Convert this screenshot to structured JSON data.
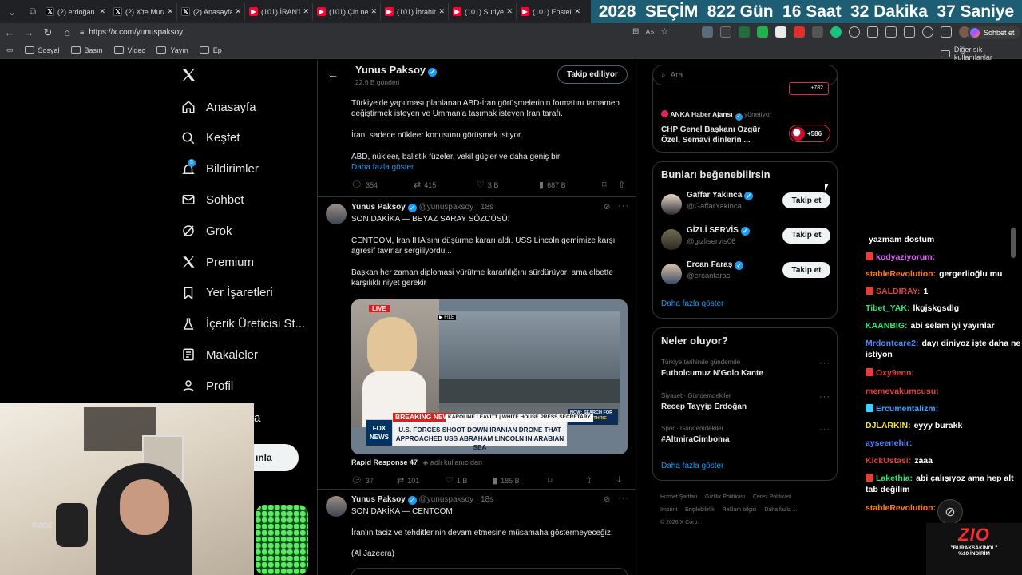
{
  "tabs": [
    {
      "label": "(2) erdoğan",
      "icon": "x-icon",
      "color": "#ffffff"
    },
    {
      "label": "(2) X'te Mura",
      "icon": "x-icon",
      "color": "#ffffff"
    },
    {
      "label": "(2) Anasayfa",
      "icon": "x-icon",
      "color": "#ffffff"
    },
    {
      "label": "(101) İRAN'D",
      "icon": "youtube-icon",
      "color": "#ff0033"
    },
    {
      "label": "(101) Çin ne",
      "icon": "youtube-icon",
      "color": "#ff0033"
    },
    {
      "label": "(101) İbrahim",
      "icon": "youtube-icon",
      "color": "#ff0033"
    },
    {
      "label": "(101) Suriye",
      "icon": "youtube-icon",
      "color": "#ff0033"
    },
    {
      "label": "(101) Epstein",
      "icon": "youtube-icon",
      "color": "#ff0033"
    }
  ],
  "countdown": {
    "year": "2028",
    "label": "SEÇİM",
    "days": "822 Gün",
    "hours": "16 Saat",
    "minutes": "32 Dakika",
    "seconds": "37 Saniye"
  },
  "address": {
    "url": "https://x.com/yunuspaksoy",
    "chat_button": "Sohbet et"
  },
  "bookmarks": [
    "Sosyal",
    "Basın",
    "Video",
    "Yayın",
    "Ep"
  ],
  "bookmarks_right": "Diğer sık kullanılanlar",
  "sidebar": {
    "items": [
      {
        "label": "Anasayfa",
        "icon": "home-icon"
      },
      {
        "label": "Keşfet",
        "icon": "search-icon"
      },
      {
        "label": "Bildirimler",
        "icon": "bell-icon",
        "badge": "3"
      },
      {
        "label": "Sohbet",
        "icon": "mail-icon"
      },
      {
        "label": "Grok",
        "icon": "grok-icon"
      },
      {
        "label": "Premium",
        "icon": "x-icon"
      },
      {
        "label": "Yer İşaretleri",
        "icon": "bookmark-icon"
      },
      {
        "label": "İçerik Üreticisi St...",
        "icon": "flask-icon"
      },
      {
        "label": "Makaleler",
        "icon": "article-icon"
      },
      {
        "label": "Profil",
        "icon": "person-icon"
      }
    ],
    "post_fragment": "ınla",
    "more_fragment": "a"
  },
  "profile_header": {
    "name": "Yunus Paksoy",
    "posts": "22,6 B gönderi",
    "follow_label": "Takip ediliyor"
  },
  "tweet0": {
    "lines": [
      "Türkiye'de yapılması planlanan ABD-İran görüşmelerinin formatını tamamen değiştirmek isteyen ve Umman'a taşımak isteyen İran tarafı.",
      "İran, sadece nükleer konusunu görüşmek istiyor.",
      "ABD, nükleer, balistik füzeler, vekil güçler ve daha geniş bir"
    ],
    "show_more": "Daha fazla göster",
    "replies": "354",
    "reposts": "415",
    "likes": "3 B",
    "views": "687 B"
  },
  "tweet1": {
    "name": "Yunus Paksoy",
    "handle": "@yunuspaksoy",
    "time": "· 18s",
    "lines": [
      "SON DAKİKA — BEYAZ SARAY SÖZCÜSÜ:",
      "CENTCOM, İran İHA'sını düşürme kararı aldı. USS Lincoln gemimize karşı agresif tavırlar sergiliyordu...",
      "Başkan her zaman diplomasi yürütme kararlılığını sürdürüyor; ama elbette karşılıklı niyet gerekir"
    ],
    "media": {
      "live": "LIVE",
      "file": "▶ FILE",
      "breaking": "BREAKING NEWS",
      "speaker": "KAROLINE LEAVITT | WHITE HOUSE PRESS SECRETARY",
      "headline1": "U.S. FORCES SHOOT DOWN IRANIAN DRONE THAT",
      "headline2": "APPROACHED USS ABRAHAM LINCOLN IN ARABIAN SEA",
      "fox1": "FOX",
      "fox2": "NEWS",
      "side1": "NOW: SEARCH FOR",
      "side2": "NANCY GUTHRIE"
    },
    "source": "Rapid Response 47",
    "source_sub": "adlı kullanıcıdan",
    "replies": "37",
    "reposts": "101",
    "likes": "1 B",
    "views": "185 B"
  },
  "tweet2": {
    "name": "Yunus Paksoy",
    "handle": "@yunuspaksoy",
    "time": "· 18s",
    "lines": [
      "SON DAKİKA — CENTCOM",
      "İran'ın taciz ve tehditlerinin devam etmesine müsamaha göstermeyeceğiz.",
      "(Al Jazeera)"
    ]
  },
  "search": {
    "placeholder": "Ara"
  },
  "news": {
    "partial_count": "+782",
    "source": "ANKA Haber Ajansı",
    "role": "yönetiyor",
    "title1": "CHP Genel Başkanı Özgür",
    "title2": "Özel, Semavi dinlerin ...",
    "count": "+586"
  },
  "suggest": {
    "title": "Bunları beğenebilirsin",
    "people": [
      {
        "name": "Gaffar Yakınca",
        "handle": "@GaffarYakinca",
        "button": "Takip et"
      },
      {
        "name": "GİZLİ SERVİS",
        "handle": "@gizliservis06",
        "button": "Takip et"
      },
      {
        "name": "Ercan Faraş",
        "handle": "@ercanfaras",
        "button": "Takip et"
      }
    ],
    "more": "Daha fazla göster"
  },
  "trends": {
    "title": "Neler oluyor?",
    "items": [
      {
        "context": "Türkiye tarihinde gündemde",
        "name": "Futbolcumuz N'Golo Kante"
      },
      {
        "context": "Siyaset · Gündemdekiler",
        "name": "Recep Tayyip Erdoğan"
      },
      {
        "context": "Spor · Gündemdekiler",
        "name": "#AltmiraCimboma"
      }
    ],
    "more": "Daha fazla göster"
  },
  "footer": {
    "links": [
      "Hizmet Şartları",
      "Gizlilik Politikası",
      "Çerez Politikası",
      "Imprint",
      "Erişilebilirlik",
      "Reklam bilgisi",
      "Daha fazla ..."
    ],
    "copy": "© 2026 X Corp."
  },
  "chat": {
    "messages": [
      {
        "user": "",
        "text": "yazmam dostum",
        "color": "#ffffff",
        "badge": ""
      },
      {
        "user": "kodyaziyorum:",
        "text": "",
        "color": "#e85cff",
        "badge": "#e0413a"
      },
      {
        "user": "stableRevolution:",
        "text": "gergerlioğlu mu",
        "color": "#ff7a1a",
        "badge": ""
      },
      {
        "user": "SALDIRAY:",
        "text": "1",
        "color": "#e0413a",
        "badge": "#e0413a"
      },
      {
        "user": "Tibet_YAK:",
        "text": "lkgjskgsdlg",
        "color": "#2de67a",
        "badge": ""
      },
      {
        "user": "KAANBIG:",
        "text": "abi selam iyi yayınlar",
        "color": "#2de67a",
        "badge": ""
      },
      {
        "user": "Mrdontcare2:",
        "text": "dayı diniyoz işte daha ne istiyon",
        "color": "#4b8bff",
        "badge": ""
      },
      {
        "user": "Oxy9enn:",
        "text": "",
        "color": "#e0413a",
        "badge": "#e0413a"
      },
      {
        "user": "memevakumcusu:",
        "text": "",
        "color": "#e0413a",
        "badge": ""
      },
      {
        "user": "Ercumentalizm:",
        "text": "",
        "color": "#3aa0ff",
        "badge": "#3ad0ff"
      },
      {
        "user": "DJLARKIN:",
        "text": "eyyy burakk",
        "color": "#f2e03a",
        "badge": ""
      },
      {
        "user": "ayseenehir:",
        "text": "",
        "color": "#4b8bff",
        "badge": ""
      },
      {
        "user": "KickUstasi:",
        "text": "zaaa",
        "color": "#e0413a",
        "badge": ""
      },
      {
        "user": "Lakethia:",
        "text": "abi çalışıyoz ama hep alt tab değilim",
        "color": "#2de67a",
        "badge": "#e0413a"
      },
      {
        "user": "stableRevolution:",
        "text": "",
        "color": "#ff7a1a",
        "badge": ""
      }
    ],
    "logo": "ZIO",
    "promo1": "\"BURAKSAKINOL\"",
    "promo2": "%10 İNDİRİM"
  },
  "colors": {
    "accent": "#1d9bf0",
    "bg": "#000000",
    "border": "#2f3336",
    "muted": "#71767b",
    "countdown_bg": "#1d5e74"
  }
}
